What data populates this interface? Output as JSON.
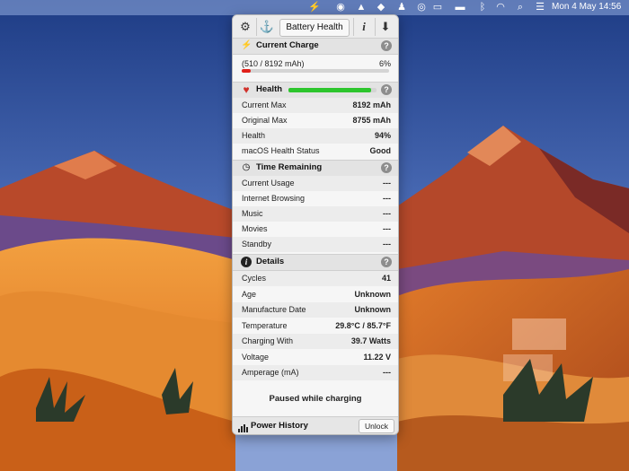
{
  "colors": {
    "charge_bar": "#e0201a",
    "health_bar": "#2cc52c",
    "heart": "#d0302a",
    "plug": "#c9a11a"
  },
  "menubar": {
    "date_time": "Mon 4 May  14:56",
    "icons": [
      "battery-app-icon",
      "accessibility-icon",
      "app-icon-a",
      "app-icon-b",
      "wallet-icon",
      "display-icon",
      "battery-status-icon",
      "bluetooth-icon",
      "wifi-icon",
      "search-icon",
      "control-center-icon"
    ]
  },
  "toolbar": {
    "settings_icon": "gear-icon",
    "anchor_icon": "anchor-icon",
    "title": "Battery Health",
    "info_icon": "info-icon",
    "download_icon": "download-icon"
  },
  "current_charge": {
    "title": "Current Charge",
    "icon": "plug-icon",
    "detail": "(510 / 8192 mAh)",
    "percent": "6%",
    "fraction": 0.06
  },
  "health": {
    "title": "Health",
    "icon": "heart-icon",
    "fraction": 0.94,
    "rows": [
      {
        "label": "Current Max",
        "value": "8192 mAh"
      },
      {
        "label": "Original Max",
        "value": "8755 mAh"
      },
      {
        "label": "Health",
        "value": "94%"
      },
      {
        "label": "macOS Health Status",
        "value": "Good"
      }
    ]
  },
  "time_remaining": {
    "title": "Time Remaining",
    "icon": "clock-icon",
    "rows": [
      {
        "label": "Current Usage",
        "value": "---"
      },
      {
        "label": "Internet Browsing",
        "value": "---"
      },
      {
        "label": "Music",
        "value": "---"
      },
      {
        "label": "Movies",
        "value": "---"
      },
      {
        "label": "Standby",
        "value": "---"
      }
    ]
  },
  "details": {
    "title": "Details",
    "icon": "info-circle-icon",
    "rows": [
      {
        "label": "Cycles",
        "value": "41"
      },
      {
        "label": "Age",
        "value": "Unknown"
      },
      {
        "label": "Manufacture Date",
        "value": "Unknown"
      },
      {
        "label": "Temperature",
        "value": "29.8°C / 85.7°F"
      },
      {
        "label": "Charging With",
        "value": "39.7 Watts"
      },
      {
        "label": "Voltage",
        "value": "11.22 V"
      },
      {
        "label": "Amperage (mA)",
        "value": "---"
      }
    ]
  },
  "status_message": "Paused while charging",
  "footer": {
    "power_history_label": "Power History",
    "unlock_label": "Unlock"
  }
}
